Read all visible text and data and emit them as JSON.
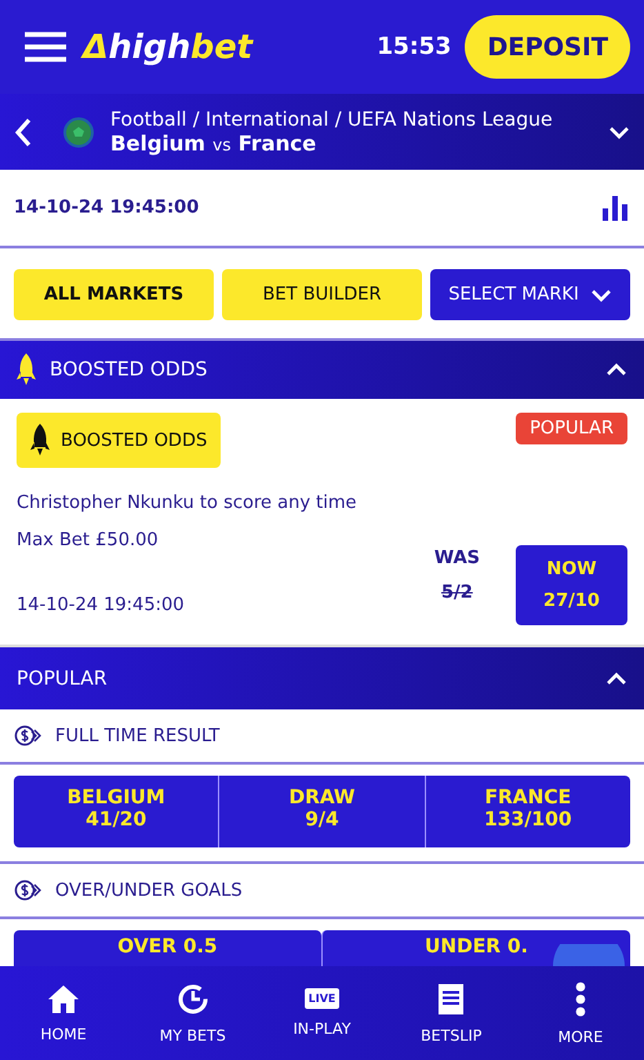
{
  "header": {
    "logo_mark": "Δ",
    "logo_first": "high",
    "logo_second": "bet",
    "time": "15:53",
    "deposit": "DEPOSIT"
  },
  "match": {
    "breadcrumb": "Football / International / UEFA Nations League",
    "home": "Belgium",
    "vs": "vs",
    "away": "France"
  },
  "date": "14-10-24 19:45:00",
  "tabs": [
    {
      "label": "ALL MARKETS",
      "kind": "tab",
      "selected": true
    },
    {
      "label": "BET BUILDER",
      "kind": "tab",
      "selected": false
    },
    {
      "label": "SELECT MARKI",
      "kind": "dropdown",
      "selected": false
    }
  ],
  "boosted": {
    "title": "BOOSTED ODDS",
    "expanded": true,
    "badge": "BOOSTED ODDS",
    "tag": "POPULAR",
    "selection": "Christopher Nkunku to score any time",
    "max_bet": "Max Bet £50.00",
    "date": "14-10-24 19:45:00",
    "was_label": "WAS",
    "was_odds": "5/2",
    "now_label": "NOW",
    "now_odds": "27/10"
  },
  "popular": {
    "title": "POPULAR",
    "expanded": true,
    "markets": [
      {
        "title": "FULL TIME RESULT",
        "outcomes": [
          {
            "name": "BELGIUM",
            "odds": "41/20"
          },
          {
            "name": "DRAW",
            "odds": "9/4"
          },
          {
            "name": "FRANCE",
            "odds": "133/100"
          }
        ]
      },
      {
        "title": "OVER/UNDER GOALS",
        "outcomes": [
          {
            "name": "OVER 0.5"
          },
          {
            "name": "UNDER 0."
          }
        ]
      }
    ]
  },
  "nav": [
    {
      "label": "HOME",
      "kind": "home"
    },
    {
      "label": "MY BETS",
      "kind": "history"
    },
    {
      "label": "IN-PLAY",
      "kind": "live",
      "icon_text": "LIVE"
    },
    {
      "label": "BETSLIP",
      "kind": "slip"
    },
    {
      "label": "MORE",
      "kind": "more"
    }
  ]
}
